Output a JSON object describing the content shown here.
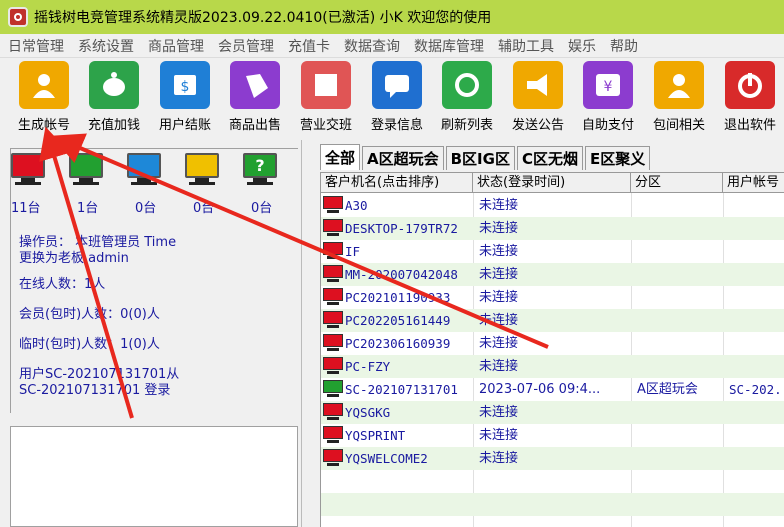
{
  "window": {
    "title": "摇钱树电竞管理系统精灵版2023.09.22.0410(已激活)  小K 欢迎您的使用"
  },
  "menu": [
    "日常管理",
    "系统设置",
    "商品管理",
    "会员管理",
    "充值卡",
    "数据查询",
    "数据库管理",
    "辅助工具",
    "娱乐",
    "帮助"
  ],
  "toolbar": [
    {
      "label": "生成帐号",
      "icon": "user-icon",
      "color": "#f0a800"
    },
    {
      "label": "充值加钱",
      "icon": "piggy-bank-icon",
      "color": "#2da34a"
    },
    {
      "label": "用户结账",
      "icon": "invoice-icon",
      "color": "#1f7fd6"
    },
    {
      "label": "商品出售",
      "icon": "sale-tag-icon",
      "color": "#8c3ccf"
    },
    {
      "label": "营业交班",
      "icon": "shop-icon",
      "color": "#e05555"
    },
    {
      "label": "登录信息",
      "icon": "message-icon",
      "color": "#1f6fd0"
    },
    {
      "label": "刷新列表",
      "icon": "refresh-icon",
      "color": "#2daa4a"
    },
    {
      "label": "发送公告",
      "icon": "megaphone-icon",
      "color": "#f0a800"
    },
    {
      "label": "自助支付",
      "icon": "yen-icon",
      "color": "#8c3ccf"
    },
    {
      "label": "包间相关",
      "icon": "person-icon",
      "color": "#f0a800"
    },
    {
      "label": "退出软件",
      "icon": "power-icon",
      "color": "#d82a2a"
    }
  ],
  "monitors": [
    {
      "count": "11台",
      "color": "#dd1020",
      "icon": "red-monitor-icon"
    },
    {
      "count": "1台",
      "color": "#22a030",
      "icon": "green-monitor-icon"
    },
    {
      "count": "0台",
      "color": "#1e88d8",
      "icon": "blue-monitor-icon"
    },
    {
      "count": "0台",
      "color": "#f0c000",
      "icon": "yellow-monitor-icon"
    },
    {
      "count": "0台",
      "color": "#22a030",
      "icon": "question-monitor-icon",
      "mark": "?"
    }
  ],
  "info": {
    "operator": "操作员： 本班管理员 Time",
    "operator2": "          更换为老板 admin",
    "online": "在线人数：1人",
    "members": "会员(包时)人数：0(0)人",
    "temps": "临时(包时)人数：1(0)人",
    "user1": "用户SC-202107131701从",
    "user2": "SC-202107131701 登录"
  },
  "tabs": [
    "全部",
    "A区超玩会",
    "B区IG区",
    "C区无烟",
    "E区聚义"
  ],
  "columns": [
    "客户机名(点击排序)",
    "状态(登录时间)",
    "分区",
    "用户帐号"
  ],
  "rows": [
    {
      "name": "A30",
      "status": "未连接",
      "zone": "",
      "user": "",
      "color": "#dd1020"
    },
    {
      "name": "DESKTOP-179TR72",
      "status": "未连接",
      "zone": "",
      "user": "",
      "color": "#dd1020"
    },
    {
      "name": "IF",
      "status": "未连接",
      "zone": "",
      "user": "",
      "color": "#dd1020"
    },
    {
      "name": "MM-202007042048",
      "status": "未连接",
      "zone": "",
      "user": "",
      "color": "#dd1020"
    },
    {
      "name": "PC202101190933",
      "status": "未连接",
      "zone": "",
      "user": "",
      "color": "#dd1020"
    },
    {
      "name": "PC202205161449",
      "status": "未连接",
      "zone": "",
      "user": "",
      "color": "#dd1020"
    },
    {
      "name": "PC202306160939",
      "status": "未连接",
      "zone": "",
      "user": "",
      "color": "#dd1020"
    },
    {
      "name": "PC-FZY",
      "status": "未连接",
      "zone": "",
      "user": "",
      "color": "#dd1020"
    },
    {
      "name": "SC-202107131701",
      "status": "2023-07-06 09:4...",
      "zone": "A区超玩会",
      "user": "SC-202.",
      "color": "#22a030"
    },
    {
      "name": "YQSGKG",
      "status": "未连接",
      "zone": "",
      "user": "",
      "color": "#dd1020"
    },
    {
      "name": "YQSPRINT",
      "status": "未连接",
      "zone": "",
      "user": "",
      "color": "#dd1020"
    },
    {
      "name": "YQSWELCOME2",
      "status": "未连接",
      "zone": "",
      "user": "",
      "color": "#dd1020"
    }
  ]
}
